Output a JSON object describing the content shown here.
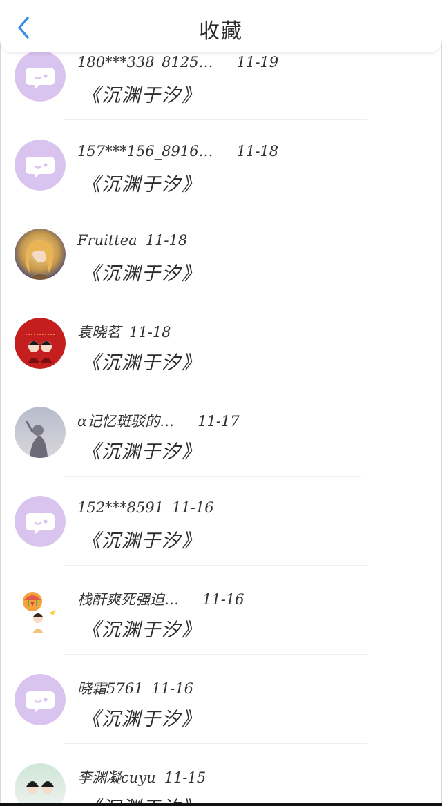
{
  "header": {
    "title": "收藏",
    "back_icon": "chevron-left-icon",
    "back_color": "#3a8ee6"
  },
  "colors": {
    "default_avatar_bg": "#d8c4ef",
    "default_avatar_bubble": "#ffffff"
  },
  "favorites": [
    {
      "user": "180***338_8125…",
      "date": "11-19",
      "book": "《沉渊于汐》",
      "avatar": "default-avatar-icon"
    },
    {
      "user": "157***156_8916…",
      "date": "11-18",
      "book": "《沉渊于汐》",
      "avatar": "default-avatar-icon"
    },
    {
      "user": "Fruittea",
      "date": "11-18",
      "book": "《沉渊于汐》",
      "avatar": "user-photo-avatar-golden"
    },
    {
      "user": "袁晓茗",
      "date": "11-18",
      "book": "《沉渊于汐》",
      "avatar": "user-photo-avatar-red"
    },
    {
      "user": "α记忆斑驳的…",
      "date": "11-17",
      "book": "《沉渊于汐》",
      "avatar": "user-photo-avatar-silhouette"
    },
    {
      "user": "152***8591",
      "date": "11-16",
      "book": "《沉渊于汐》",
      "avatar": "default-avatar-icon"
    },
    {
      "user": "栈酐爽死强迫…",
      "date": "11-16",
      "book": "《沉渊于汐》",
      "avatar": "user-photo-avatar-balloon"
    },
    {
      "user": "晓霜5761",
      "date": "11-16",
      "book": "《沉渊于汐》",
      "avatar": "default-avatar-icon"
    },
    {
      "user": "李渊凝cuyu",
      "date": "11-15",
      "book": "《沉渊于汐》",
      "avatar": "user-photo-avatar-couple"
    }
  ]
}
